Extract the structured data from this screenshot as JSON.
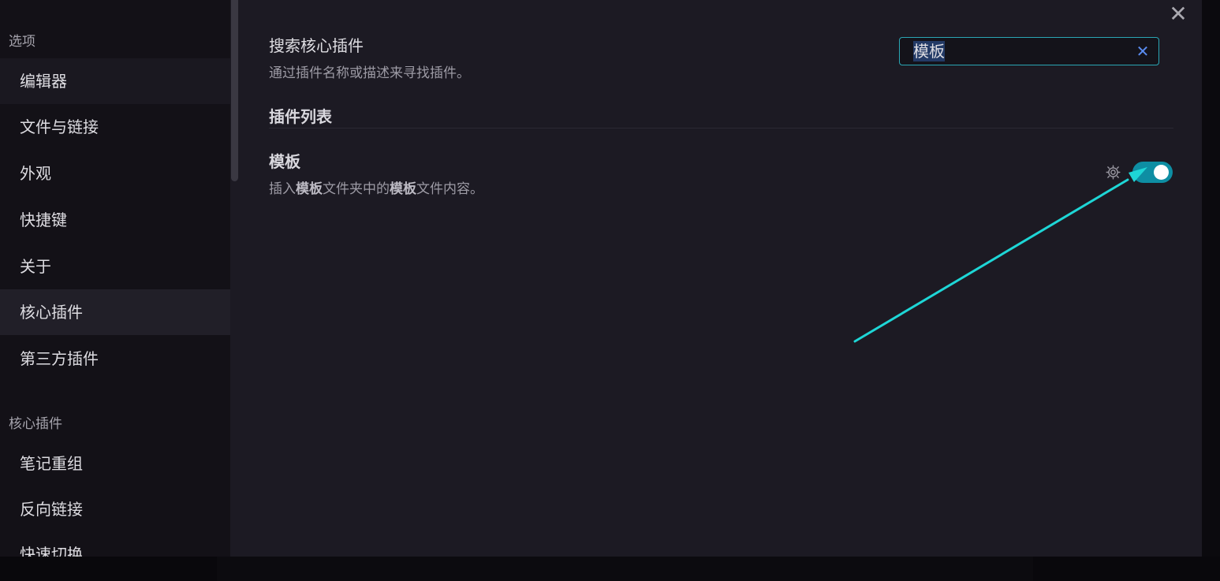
{
  "sidebar": {
    "section_options": "选项",
    "options_items": [
      {
        "label": "编辑器"
      },
      {
        "label": "文件与链接"
      },
      {
        "label": "外观"
      },
      {
        "label": "快捷键"
      },
      {
        "label": "关于"
      },
      {
        "label": "核心插件"
      },
      {
        "label": "第三方插件"
      }
    ],
    "active_item": "核心插件",
    "section_core_plugins": "核心插件",
    "core_plugin_items": [
      {
        "label": "笔记重组"
      },
      {
        "label": "反向链接"
      },
      {
        "label": "快速切换"
      }
    ]
  },
  "main": {
    "search_setting": {
      "title": "搜索核心插件",
      "description": "通过插件名称或描述来寻找插件。",
      "value": "模板"
    },
    "list_heading": "插件列表",
    "plugins": [
      {
        "name": "模板",
        "description_parts": [
          "插入",
          "模板",
          "文件夹中的",
          "模板",
          "文件内容。"
        ],
        "enabled": true
      }
    ]
  },
  "icons": {
    "close": "close-icon",
    "clear": "clear-icon",
    "settings": "gear-icon"
  },
  "colors": {
    "accent": "#0e8ea3",
    "annotation_arrow": "#1ed6d6",
    "search_border": "#2aa6b4"
  }
}
